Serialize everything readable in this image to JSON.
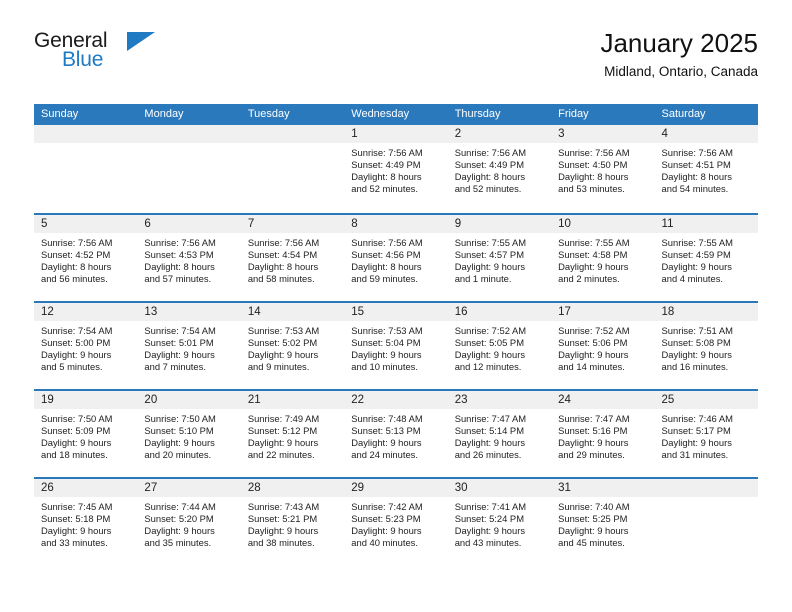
{
  "logo": {
    "text_top": "General",
    "text_bottom": "Blue",
    "triangle_icon": "logo-triangle-icon",
    "color_blue": "#1f79c3",
    "color_black": "#1a1a1a"
  },
  "header": {
    "title": "January 2025",
    "subtitle": "Midland, Ontario, Canada"
  },
  "theme": {
    "header_blue": "#2b79bd",
    "day_number_band": "#f0f0f0",
    "text": "#222222"
  },
  "weekdays": [
    "Sunday",
    "Monday",
    "Tuesday",
    "Wednesday",
    "Thursday",
    "Friday",
    "Saturday"
  ],
  "weeks": [
    [
      {
        "day": "",
        "sunrise": "",
        "sunset": "",
        "daylight1": "",
        "daylight2": ""
      },
      {
        "day": "",
        "sunrise": "",
        "sunset": "",
        "daylight1": "",
        "daylight2": ""
      },
      {
        "day": "",
        "sunrise": "",
        "sunset": "",
        "daylight1": "",
        "daylight2": ""
      },
      {
        "day": "1",
        "sunrise": "Sunrise: 7:56 AM",
        "sunset": "Sunset: 4:49 PM",
        "daylight1": "Daylight: 8 hours",
        "daylight2": "and 52 minutes."
      },
      {
        "day": "2",
        "sunrise": "Sunrise: 7:56 AM",
        "sunset": "Sunset: 4:49 PM",
        "daylight1": "Daylight: 8 hours",
        "daylight2": "and 52 minutes."
      },
      {
        "day": "3",
        "sunrise": "Sunrise: 7:56 AM",
        "sunset": "Sunset: 4:50 PM",
        "daylight1": "Daylight: 8 hours",
        "daylight2": "and 53 minutes."
      },
      {
        "day": "4",
        "sunrise": "Sunrise: 7:56 AM",
        "sunset": "Sunset: 4:51 PM",
        "daylight1": "Daylight: 8 hours",
        "daylight2": "and 54 minutes."
      }
    ],
    [
      {
        "day": "5",
        "sunrise": "Sunrise: 7:56 AM",
        "sunset": "Sunset: 4:52 PM",
        "daylight1": "Daylight: 8 hours",
        "daylight2": "and 56 minutes."
      },
      {
        "day": "6",
        "sunrise": "Sunrise: 7:56 AM",
        "sunset": "Sunset: 4:53 PM",
        "daylight1": "Daylight: 8 hours",
        "daylight2": "and 57 minutes."
      },
      {
        "day": "7",
        "sunrise": "Sunrise: 7:56 AM",
        "sunset": "Sunset: 4:54 PM",
        "daylight1": "Daylight: 8 hours",
        "daylight2": "and 58 minutes."
      },
      {
        "day": "8",
        "sunrise": "Sunrise: 7:56 AM",
        "sunset": "Sunset: 4:56 PM",
        "daylight1": "Daylight: 8 hours",
        "daylight2": "and 59 minutes."
      },
      {
        "day": "9",
        "sunrise": "Sunrise: 7:55 AM",
        "sunset": "Sunset: 4:57 PM",
        "daylight1": "Daylight: 9 hours",
        "daylight2": "and 1 minute."
      },
      {
        "day": "10",
        "sunrise": "Sunrise: 7:55 AM",
        "sunset": "Sunset: 4:58 PM",
        "daylight1": "Daylight: 9 hours",
        "daylight2": "and 2 minutes."
      },
      {
        "day": "11",
        "sunrise": "Sunrise: 7:55 AM",
        "sunset": "Sunset: 4:59 PM",
        "daylight1": "Daylight: 9 hours",
        "daylight2": "and 4 minutes."
      }
    ],
    [
      {
        "day": "12",
        "sunrise": "Sunrise: 7:54 AM",
        "sunset": "Sunset: 5:00 PM",
        "daylight1": "Daylight: 9 hours",
        "daylight2": "and 5 minutes."
      },
      {
        "day": "13",
        "sunrise": "Sunrise: 7:54 AM",
        "sunset": "Sunset: 5:01 PM",
        "daylight1": "Daylight: 9 hours",
        "daylight2": "and 7 minutes."
      },
      {
        "day": "14",
        "sunrise": "Sunrise: 7:53 AM",
        "sunset": "Sunset: 5:02 PM",
        "daylight1": "Daylight: 9 hours",
        "daylight2": "and 9 minutes."
      },
      {
        "day": "15",
        "sunrise": "Sunrise: 7:53 AM",
        "sunset": "Sunset: 5:04 PM",
        "daylight1": "Daylight: 9 hours",
        "daylight2": "and 10 minutes."
      },
      {
        "day": "16",
        "sunrise": "Sunrise: 7:52 AM",
        "sunset": "Sunset: 5:05 PM",
        "daylight1": "Daylight: 9 hours",
        "daylight2": "and 12 minutes."
      },
      {
        "day": "17",
        "sunrise": "Sunrise: 7:52 AM",
        "sunset": "Sunset: 5:06 PM",
        "daylight1": "Daylight: 9 hours",
        "daylight2": "and 14 minutes."
      },
      {
        "day": "18",
        "sunrise": "Sunrise: 7:51 AM",
        "sunset": "Sunset: 5:08 PM",
        "daylight1": "Daylight: 9 hours",
        "daylight2": "and 16 minutes."
      }
    ],
    [
      {
        "day": "19",
        "sunrise": "Sunrise: 7:50 AM",
        "sunset": "Sunset: 5:09 PM",
        "daylight1": "Daylight: 9 hours",
        "daylight2": "and 18 minutes."
      },
      {
        "day": "20",
        "sunrise": "Sunrise: 7:50 AM",
        "sunset": "Sunset: 5:10 PM",
        "daylight1": "Daylight: 9 hours",
        "daylight2": "and 20 minutes."
      },
      {
        "day": "21",
        "sunrise": "Sunrise: 7:49 AM",
        "sunset": "Sunset: 5:12 PM",
        "daylight1": "Daylight: 9 hours",
        "daylight2": "and 22 minutes."
      },
      {
        "day": "22",
        "sunrise": "Sunrise: 7:48 AM",
        "sunset": "Sunset: 5:13 PM",
        "daylight1": "Daylight: 9 hours",
        "daylight2": "and 24 minutes."
      },
      {
        "day": "23",
        "sunrise": "Sunrise: 7:47 AM",
        "sunset": "Sunset: 5:14 PM",
        "daylight1": "Daylight: 9 hours",
        "daylight2": "and 26 minutes."
      },
      {
        "day": "24",
        "sunrise": "Sunrise: 7:47 AM",
        "sunset": "Sunset: 5:16 PM",
        "daylight1": "Daylight: 9 hours",
        "daylight2": "and 29 minutes."
      },
      {
        "day": "25",
        "sunrise": "Sunrise: 7:46 AM",
        "sunset": "Sunset: 5:17 PM",
        "daylight1": "Daylight: 9 hours",
        "daylight2": "and 31 minutes."
      }
    ],
    [
      {
        "day": "26",
        "sunrise": "Sunrise: 7:45 AM",
        "sunset": "Sunset: 5:18 PM",
        "daylight1": "Daylight: 9 hours",
        "daylight2": "and 33 minutes."
      },
      {
        "day": "27",
        "sunrise": "Sunrise: 7:44 AM",
        "sunset": "Sunset: 5:20 PM",
        "daylight1": "Daylight: 9 hours",
        "daylight2": "and 35 minutes."
      },
      {
        "day": "28",
        "sunrise": "Sunrise: 7:43 AM",
        "sunset": "Sunset: 5:21 PM",
        "daylight1": "Daylight: 9 hours",
        "daylight2": "and 38 minutes."
      },
      {
        "day": "29",
        "sunrise": "Sunrise: 7:42 AM",
        "sunset": "Sunset: 5:23 PM",
        "daylight1": "Daylight: 9 hours",
        "daylight2": "and 40 minutes."
      },
      {
        "day": "30",
        "sunrise": "Sunrise: 7:41 AM",
        "sunset": "Sunset: 5:24 PM",
        "daylight1": "Daylight: 9 hours",
        "daylight2": "and 43 minutes."
      },
      {
        "day": "31",
        "sunrise": "Sunrise: 7:40 AM",
        "sunset": "Sunset: 5:25 PM",
        "daylight1": "Daylight: 9 hours",
        "daylight2": "and 45 minutes."
      },
      {
        "day": "",
        "sunrise": "",
        "sunset": "",
        "daylight1": "",
        "daylight2": ""
      }
    ]
  ]
}
